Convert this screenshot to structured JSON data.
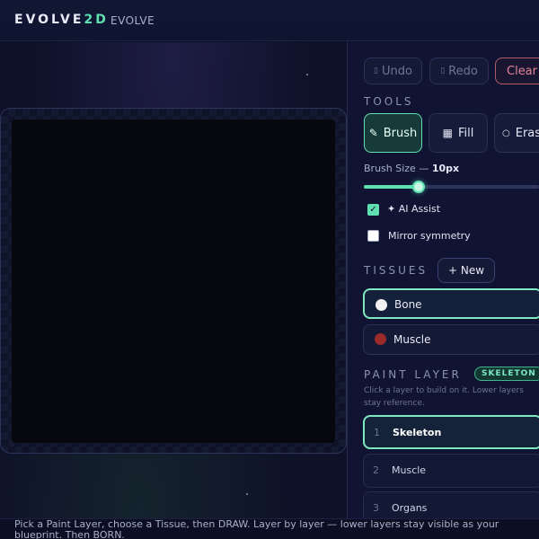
{
  "header": {
    "brand_main": "EVOLVE",
    "brand_accent": "2D",
    "subtitle": "EVOLVE"
  },
  "toolbar": {
    "undo": "Undo",
    "redo": "Redo",
    "clear": "Clear"
  },
  "tools": {
    "title": "TOOLS",
    "items": [
      {
        "label": "Brush",
        "icon": "brush-icon",
        "active": true
      },
      {
        "label": "Fill",
        "icon": "grid-icon",
        "active": false
      },
      {
        "label": "Erase",
        "icon": "circle-icon",
        "active": false
      }
    ]
  },
  "brush_size": {
    "label": "Brush Size —",
    "value": "10px",
    "fraction": 0.31
  },
  "options": [
    {
      "label": "AI Assist",
      "checked": true
    },
    {
      "label": "Mirror symmetry",
      "checked": false
    }
  ],
  "tissues": {
    "title": "TISSUES",
    "new_label": "+ New",
    "items": [
      {
        "name": "Bone",
        "color": "#f2f2f2",
        "active": true
      },
      {
        "name": "Muscle",
        "color": "#9b2a2a",
        "active": false
      }
    ]
  },
  "paint_layer": {
    "title": "PAINT LAYER",
    "badge": "SKELETON",
    "hint": "Click a layer to build on it. Lower layers stay reference.",
    "layers": [
      {
        "num": "1",
        "name": "Skeleton",
        "active": true
      },
      {
        "num": "2",
        "name": "Muscle",
        "active": false
      },
      {
        "num": "3",
        "name": "Organs",
        "active": false
      }
    ]
  },
  "footer": {
    "text": "Pick a Paint Layer, choose a Tissue, then DRAW. Layer by layer — lower layers stay visible as your blueprint. Then BORN."
  },
  "colors": {
    "accent": "#5fe0b0",
    "danger": "#e38497",
    "background": "#0d1022"
  }
}
